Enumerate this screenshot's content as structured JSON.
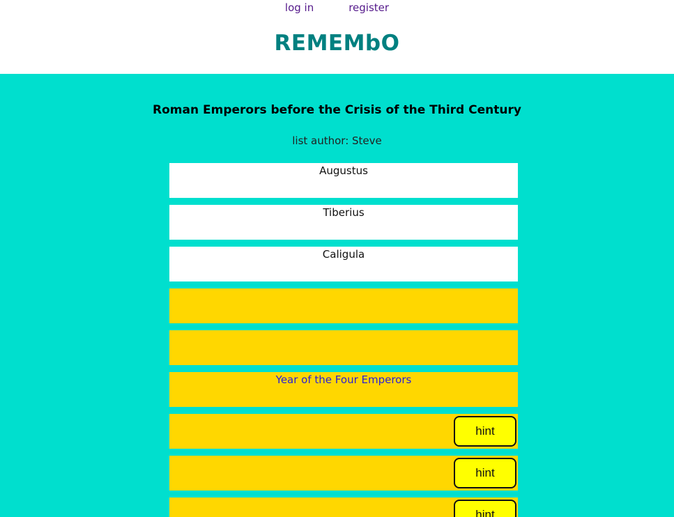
{
  "nav": {
    "login_label": "log in",
    "register_label": "register"
  },
  "brand": {
    "title": "REMEMbO"
  },
  "list": {
    "title": "Roman Emperors before the Crisis of the Third Century",
    "author": "list author: Steve",
    "items": [
      {
        "state": "revealed",
        "text": "Augustus"
      },
      {
        "state": "revealed",
        "text": "Tiberius"
      },
      {
        "state": "revealed",
        "text": "Caligula"
      },
      {
        "state": "hidden",
        "text": ""
      },
      {
        "state": "hidden",
        "text": ""
      },
      {
        "state": "hidden",
        "text": "Year of the Four Emperors"
      },
      {
        "state": "hidden",
        "hint_label": "hint"
      },
      {
        "state": "hidden",
        "hint_label": "hint"
      },
      {
        "state": "hidden",
        "hint_label": "hint"
      }
    ]
  },
  "colors": {
    "brand": "#008080",
    "background": "#00dfce",
    "hidden_item": "#ffd700",
    "hint_button": "#ffff00"
  }
}
